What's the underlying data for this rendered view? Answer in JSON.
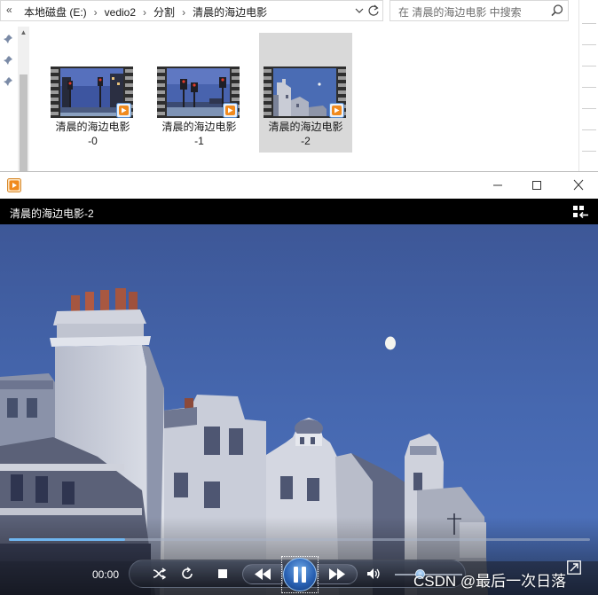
{
  "explorer": {
    "breadcrumb": [
      "本地磁盘 (E:)",
      "vedio2",
      "分割",
      "清晨的海边电影"
    ],
    "search_placeholder": "在 清晨的海边电影 中搜索",
    "files": [
      {
        "name_line1": "清晨的海边电影",
        "name_line2": "-0",
        "selected": false
      },
      {
        "name_line1": "清晨的海边电影",
        "name_line2": "-1",
        "selected": false
      },
      {
        "name_line1": "清晨的海边电影",
        "name_line2": "-2",
        "selected": true
      }
    ],
    "icons": {
      "back": "double-chevron-left-icon",
      "dropdown": "chevron-down-icon",
      "refresh": "refresh-icon",
      "search": "search-icon",
      "pin": "pin-icon",
      "file_badge": "media-player-badge-icon"
    },
    "colors": {
      "selection": "#d9d9d9",
      "border": "#d9d9d9"
    }
  },
  "player": {
    "title": "清晨的海边电影-2",
    "time": "00:00",
    "seek_progress_fraction": 0.2,
    "volume_fraction": 0.37,
    "state": "playing",
    "icons": {
      "app": "media-player-icon",
      "minimize": "minimize-icon",
      "maximize": "maximize-icon",
      "close": "close-icon",
      "library": "switch-to-library-icon",
      "shuffle": "shuffle-icon",
      "repeat": "repeat-icon",
      "stop": "stop-icon",
      "previous": "previous-icon",
      "pause": "pause-icon",
      "next": "next-icon",
      "volume": "volume-icon",
      "fullscreen": "fullscreen-icon"
    },
    "colors": {
      "accent": "#2a62b4",
      "seek_fill": "#6fb6f0",
      "sky": "#4668b0"
    }
  },
  "watermark": "CSDN @最后一次日落"
}
